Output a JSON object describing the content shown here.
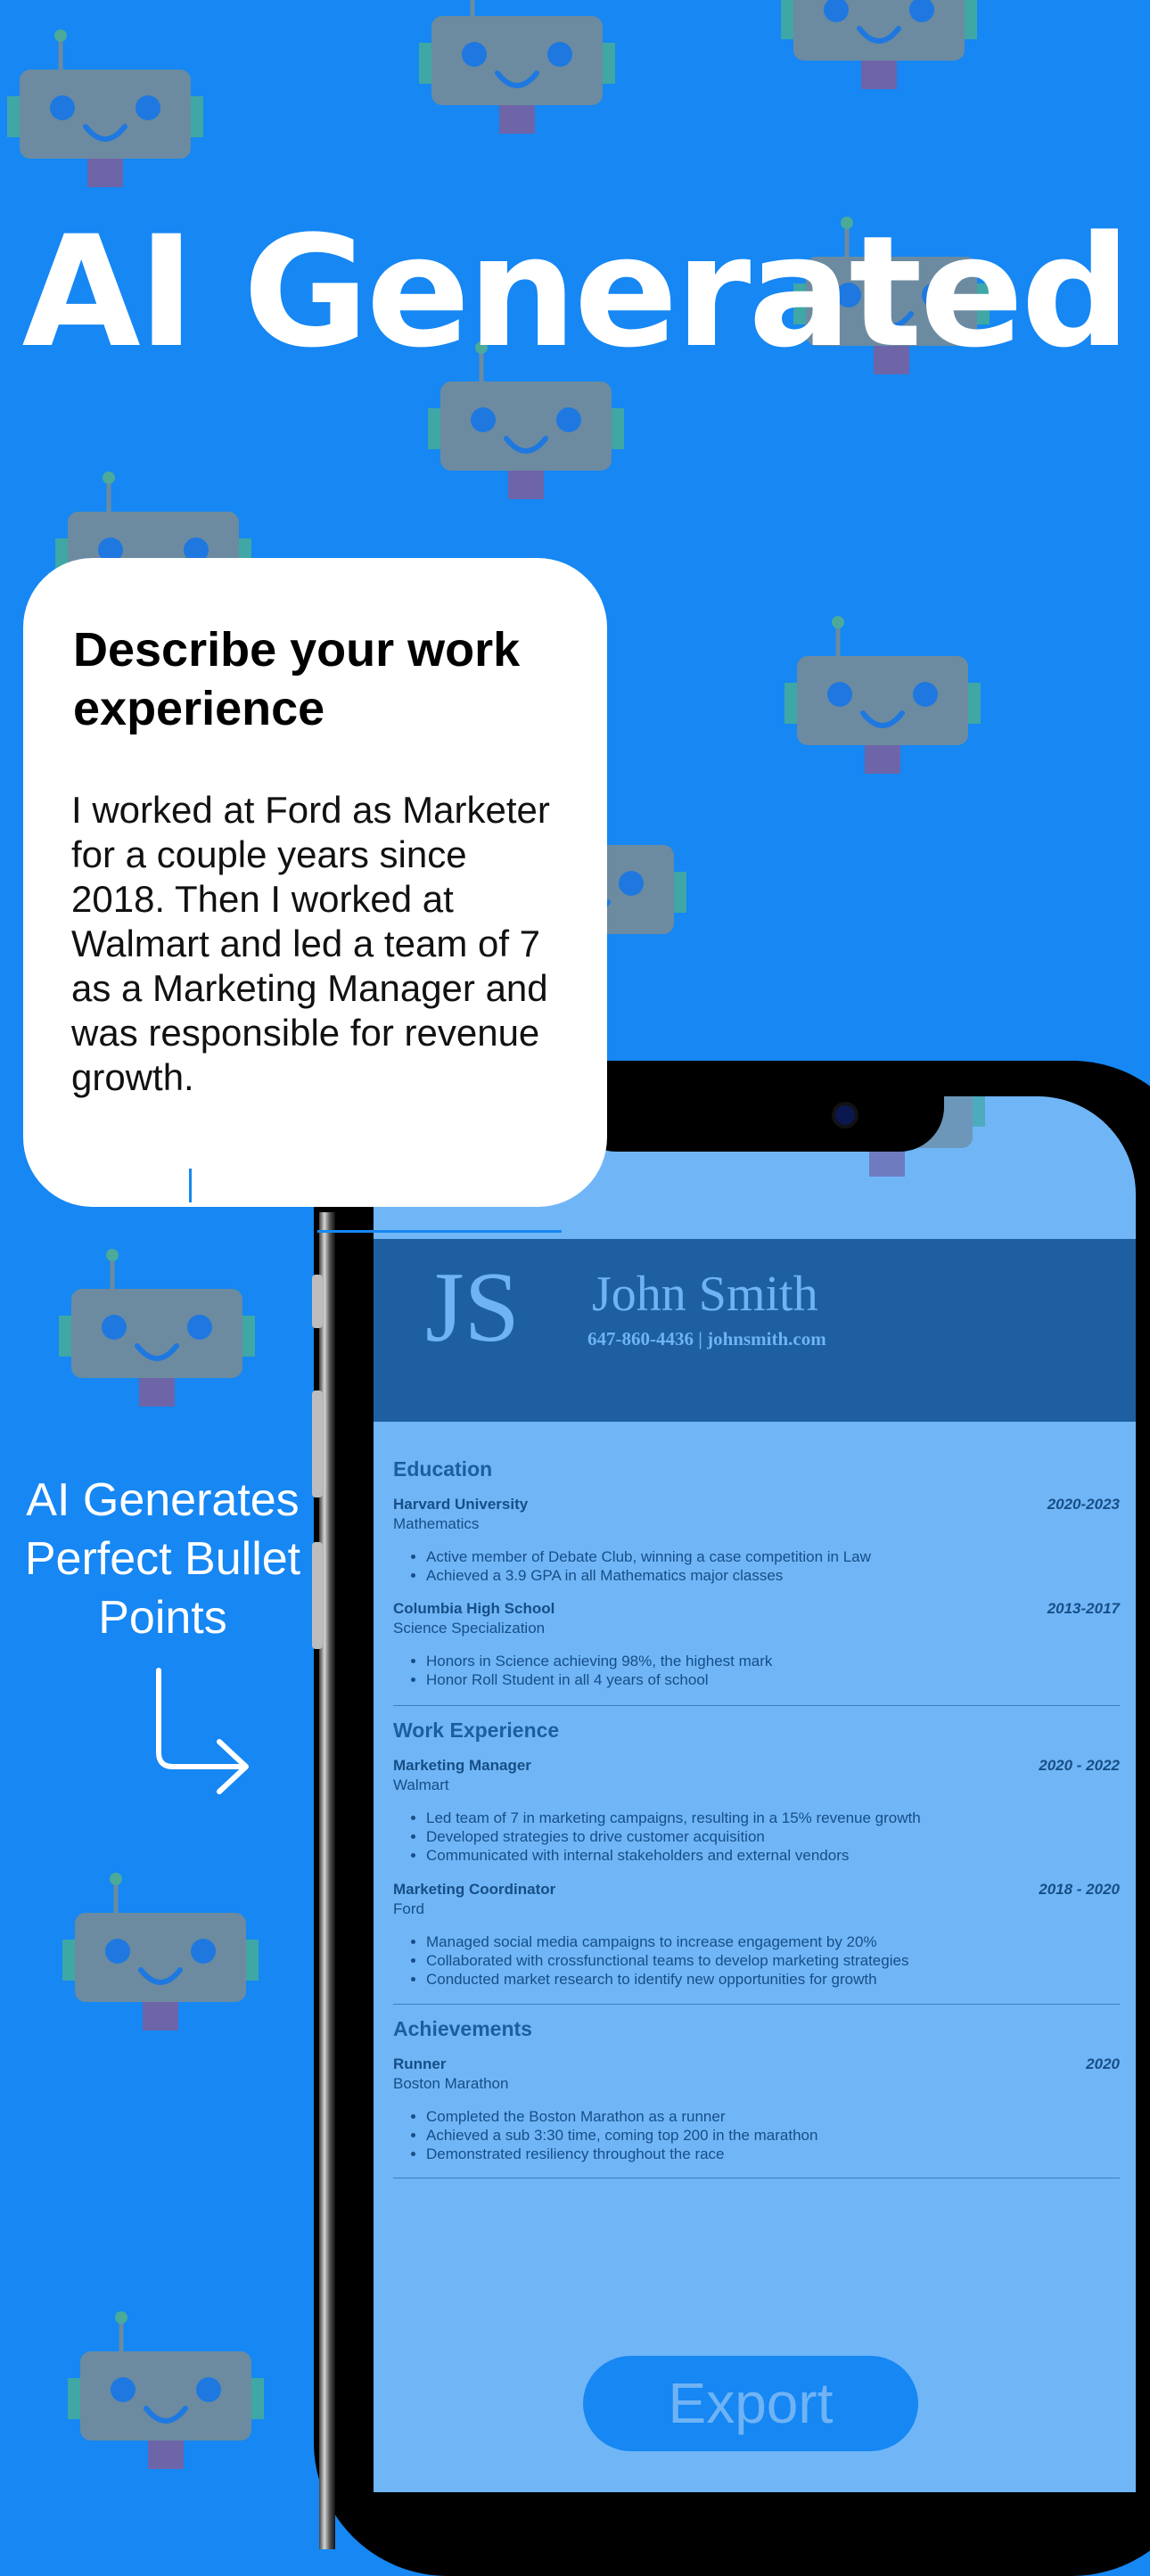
{
  "headline": "AI Generated",
  "prompt_card": {
    "title": "Describe your work experience",
    "body": "I worked at Ford as Marketer\nfor a couple years since\n2018. Then I worked at\nWalmart and led a team of 7\nas a Marketing Manager and\nwas responsible for revenue\ngrowth."
  },
  "side_caption": "AI Generates Perfect Bullet Points",
  "resume": {
    "initials": "JS",
    "name": "John Smith",
    "contact": "647-860-4436 | johnsmith.com",
    "education": {
      "heading": "Education",
      "entries": [
        {
          "title": "Harvard University",
          "date": "2020-2023",
          "subtitle": "Mathematics",
          "bullets": [
            "Active member of Debate Club, winning a case competition in Law",
            "Achieved a 3.9 GPA in all Mathematics major classes"
          ]
        },
        {
          "title": "Columbia High School",
          "date": "2013-2017",
          "subtitle": "Science Specialization",
          "bullets": [
            "Honors in Science achieving 98%, the highest mark",
            "Honor Roll Student in all 4 years of school"
          ]
        }
      ]
    },
    "work": {
      "heading": "Work Experience",
      "entries": [
        {
          "title": "Marketing Manager",
          "date": "2020 - 2022",
          "subtitle": "Walmart",
          "bullets": [
            "Led team of 7 in marketing campaigns, resulting in a 15% revenue growth",
            "Developed strategies to drive customer acquisition",
            "Communicated with internal stakeholders and external vendors"
          ]
        },
        {
          "title": "Marketing Coordinator",
          "date": "2018 - 2020",
          "subtitle": "Ford",
          "bullets": [
            "Managed social media campaigns to increase engagement by 20%",
            "Collaborated with crossfunctional teams to develop  marketing strategies",
            "Conducted market research to identify new opportunities for growth"
          ]
        }
      ]
    },
    "achievements": {
      "heading": "Achievements",
      "entries": [
        {
          "title": "Runner",
          "date": "2020",
          "subtitle": "Boston Marathon",
          "bullets": [
            "Completed the Boston Marathon as a runner",
            "Achieved a sub 3:30 time, coming top 200 in the marathon",
            "Demonstrated resiliency throughout the race"
          ]
        }
      ]
    }
  },
  "export_label": "Export",
  "colors": {
    "background": "#1687F3",
    "screen": "#70B6F7",
    "header": "#1D5FA0",
    "robot": "#6C8BA0"
  }
}
